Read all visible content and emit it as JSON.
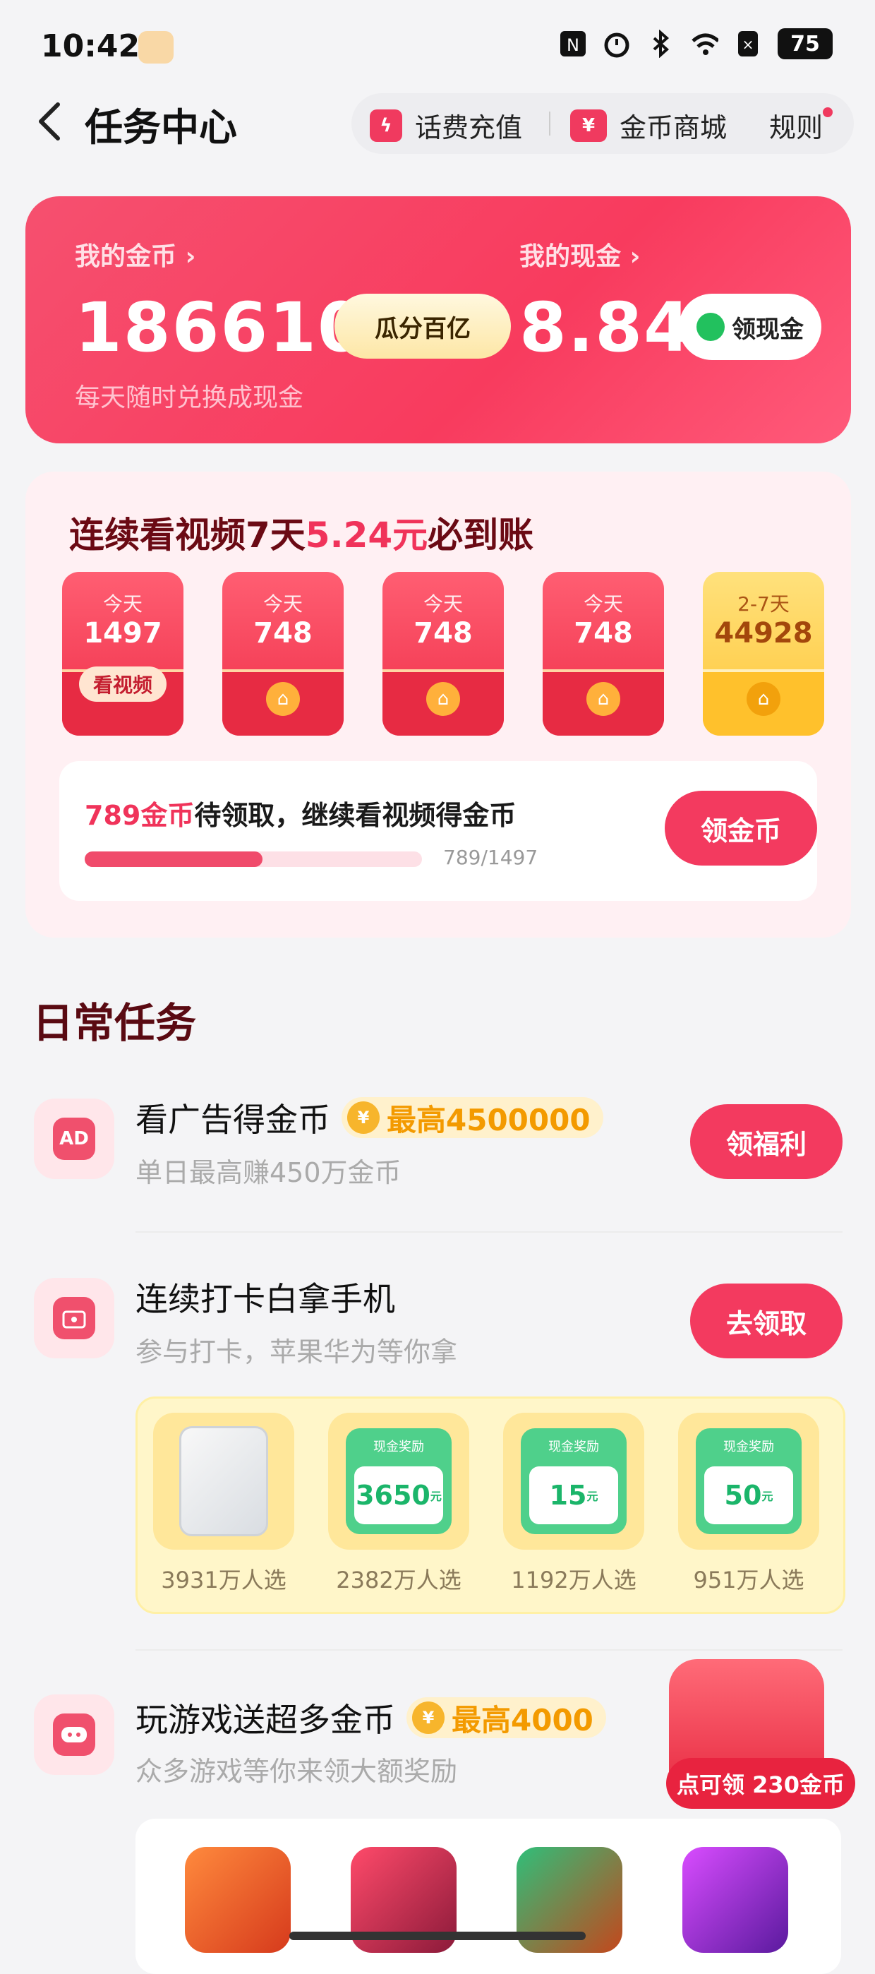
{
  "status_bar": {
    "time": "10:42",
    "battery": "75"
  },
  "header": {
    "title": "任务中心",
    "actions": [
      {
        "label": "话费充值",
        "icon": "lightning-icon"
      },
      {
        "label": "金币商城",
        "icon": "ticket-icon"
      },
      {
        "label": "规则"
      }
    ]
  },
  "wallet": {
    "coins_label": "我的金币",
    "coins_value": "186610",
    "coins_hint": "每天随时兑换成现金",
    "guafen_label": "瓜分百亿",
    "cash_label": "我的现金",
    "cash_value": "8.84",
    "withdraw_label": "领现金"
  },
  "streak": {
    "title_prefix": "连续看视频7天",
    "title_amount": "5.24元",
    "title_suffix": "必到账",
    "days": [
      {
        "label": "今天",
        "value": "1497",
        "button": "看视频"
      },
      {
        "label": "今天",
        "value": "748"
      },
      {
        "label": "今天",
        "value": "748"
      },
      {
        "label": "今天",
        "value": "748"
      },
      {
        "label": "2-7天",
        "value": "44928"
      }
    ],
    "pending_amount": "789金币",
    "pending_text": "待领取，继续看视频得金币",
    "progress_label": "789/1497",
    "progress_fraction": 0.527,
    "claim_label": "领金币"
  },
  "daily": {
    "section_title": "日常任务",
    "tasks": [
      {
        "title": "看广告得金币",
        "tag": "最高4500000",
        "subtitle": "单日最高赚450万金币",
        "button": "领福利",
        "icon_text": "AD"
      },
      {
        "title": "连续打卡白拿手机",
        "subtitle": "参与打卡，苹果华为等你拿",
        "button": "去领取"
      },
      {
        "title": "玩游戏送超多金币",
        "tag": "最高4000",
        "subtitle": "众多游戏等你来领大额奖励"
      }
    ],
    "prizes": [
      {
        "label": "3931万人选"
      },
      {
        "header": "现金奖励",
        "value": "3650",
        "unit": "元",
        "label": "2382万人选"
      },
      {
        "header": "现金奖励",
        "value": "15",
        "unit": "元",
        "label": "1192万人选"
      },
      {
        "header": "现金奖励",
        "value": "50",
        "unit": "元",
        "label": "951万人选"
      }
    ],
    "game_bonus": "点可领 230金币"
  }
}
